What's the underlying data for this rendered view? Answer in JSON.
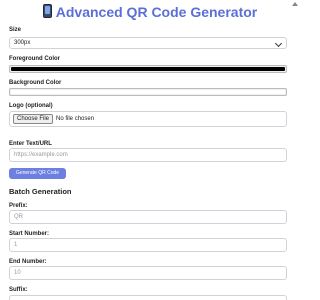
{
  "app": {
    "title": "Advanced QR Code Generator",
    "title_icon": "mobile-phone-icon"
  },
  "form": {
    "size": {
      "label": "Size",
      "value": "300px"
    },
    "foreground": {
      "label": "Foreground Color",
      "value": "#000000"
    },
    "background": {
      "label": "Background Color",
      "value": "#ffffff"
    },
    "logo": {
      "label": "Logo (optional)",
      "button": "Choose File",
      "status": "No file chosen"
    },
    "text": {
      "label": "Enter Text/URL",
      "placeholder": "https://example.com"
    },
    "generate_button": "Generate QR Code"
  },
  "batch": {
    "title": "Batch Generation",
    "prefix": {
      "label": "Prefix:",
      "placeholder": "QR"
    },
    "start": {
      "label": "Start Number:",
      "placeholder": "1"
    },
    "end": {
      "label": "End Number:",
      "placeholder": "10"
    },
    "suffix": {
      "label": "Suffix:"
    }
  },
  "colors": {
    "accent": "#5b6fd6",
    "button": "#6d7fe0"
  }
}
